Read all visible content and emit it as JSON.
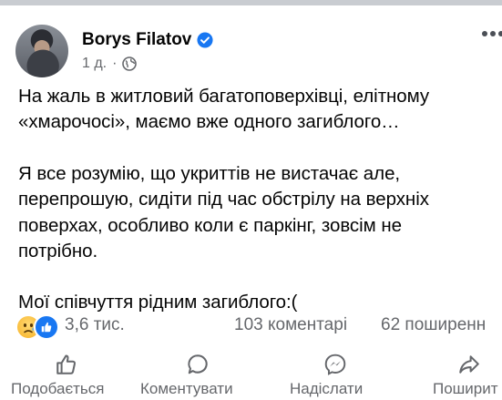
{
  "post": {
    "author": "Borys Filatov",
    "time": "1 д.",
    "separator": "·",
    "paragraphs": [
      "На жаль в житловий багатоповерхівці, елітному\n«хмарочосі», маємо вже одного загиблого…",
      "Я все розумію, що укриттів не вистачає але,\nперепрошую, сидіти під час обстрілу на верхніх\nповерхах, особливо коли є паркінг, зовсім не\nпотрібно.",
      "Мої співчуття рідним загиблого:("
    ]
  },
  "stats": {
    "reactions": "3,6 тис.",
    "comments": "103 коментарі",
    "shares": "62 поширенн"
  },
  "actions": {
    "like": "Подобається",
    "comment": "Коментувати",
    "send": "Надіслати",
    "share": "Поширит"
  },
  "colors": {
    "accent": "#1877f2",
    "secondary_text": "#65676b"
  },
  "icons": [
    "avatar",
    "verified-badge-icon",
    "globe-icon",
    "more-options-icon",
    "sad-reaction-icon",
    "like-reaction-icon",
    "like-icon",
    "comment-icon",
    "messenger-icon",
    "share-icon"
  ]
}
